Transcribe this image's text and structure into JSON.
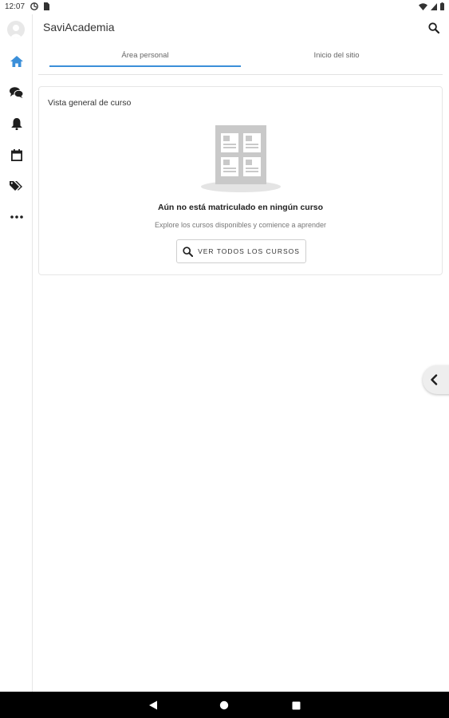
{
  "status_bar": {
    "time": "12:07",
    "left_icons": [
      "sync-icon",
      "sim-icon"
    ],
    "right_icons": [
      "wifi-icon",
      "signal-icon",
      "battery-icon"
    ]
  },
  "rail": {
    "items": [
      {
        "icon": "home-icon",
        "active": true
      },
      {
        "icon": "chat-icon",
        "active": false
      },
      {
        "icon": "bell-icon",
        "active": false
      },
      {
        "icon": "calendar-icon",
        "active": false
      },
      {
        "icon": "tags-icon",
        "active": false
      },
      {
        "icon": "more-icon",
        "active": false
      }
    ]
  },
  "header": {
    "title": "SaviAcademia"
  },
  "tabs": [
    {
      "label": "Área personal",
      "selected": true
    },
    {
      "label": "Inicio del sitio",
      "selected": false
    }
  ],
  "course_overview": {
    "title": "Vista general de curso",
    "empty_title": "Aún no está matriculado en ningún curso",
    "empty_subtitle": "Explore los cursos disponibles y comience a aprender",
    "button_label": "VER TODOS LOS CURSOS"
  },
  "colors": {
    "accent": "#3b8fd9",
    "icon_dark": "#1e1e1e",
    "illustration_gray": "#c9c9c9"
  },
  "nav_bar": {
    "buttons": [
      "back-icon",
      "home-circle-icon",
      "recents-icon"
    ]
  }
}
